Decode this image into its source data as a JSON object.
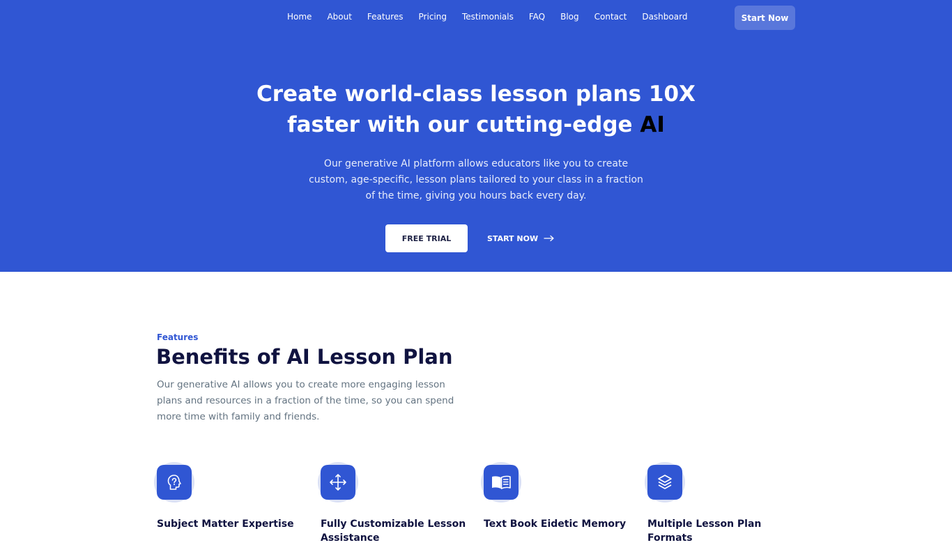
{
  "nav": {
    "links": [
      "Home",
      "About",
      "Features",
      "Pricing",
      "Testimonials",
      "FAQ",
      "Blog",
      "Contact",
      "Dashboard"
    ],
    "cta": "Start Now"
  },
  "hero": {
    "title_line1": "Create world-class lesson plans 10X",
    "title_line2": "faster with our cutting-edge",
    "title_accent": "AI",
    "subtitle": "Our generative AI platform allows educators like you to create custom, age-specific, lesson plans tailored to your class in a fraction of the time, giving you hours back every day.",
    "primary_button": "FREE TRIAL",
    "secondary_button": "START NOW",
    "secondary_icon": "arrow-right-icon"
  },
  "features": {
    "tag": "Features",
    "title": "Benefits of AI Lesson Plan",
    "description": "Our generative AI allows you to create more engaging lesson plans and resources in a fraction of the time, so you can spend more time with family and friends.",
    "items": [
      {
        "title": "Subject Matter Expertise",
        "icon": "brain-icon"
      },
      {
        "title": "Fully Customizable Lesson Assistance",
        "icon": "move-arrows-icon"
      },
      {
        "title": "Text Book Eidetic Memory",
        "icon": "open-book-icon"
      },
      {
        "title": "Multiple Lesson Plan Formats",
        "icon": "layers-icon"
      }
    ]
  },
  "colors": {
    "primary": "#3056d3",
    "heading": "#101340",
    "body_text": "#637381"
  }
}
